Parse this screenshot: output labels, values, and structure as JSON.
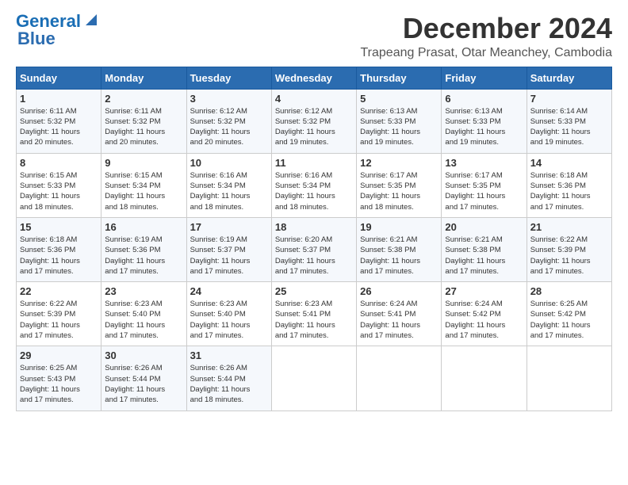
{
  "logo": {
    "line1": "General",
    "line2": "Blue"
  },
  "title": {
    "month_year": "December 2024",
    "location": "Trapeang Prasat, Otar Meanchey, Cambodia"
  },
  "days_of_week": [
    "Sunday",
    "Monday",
    "Tuesday",
    "Wednesday",
    "Thursday",
    "Friday",
    "Saturday"
  ],
  "weeks": [
    [
      {
        "day": "1",
        "info": "Sunrise: 6:11 AM\nSunset: 5:32 PM\nDaylight: 11 hours\nand 20 minutes."
      },
      {
        "day": "2",
        "info": "Sunrise: 6:11 AM\nSunset: 5:32 PM\nDaylight: 11 hours\nand 20 minutes."
      },
      {
        "day": "3",
        "info": "Sunrise: 6:12 AM\nSunset: 5:32 PM\nDaylight: 11 hours\nand 20 minutes."
      },
      {
        "day": "4",
        "info": "Sunrise: 6:12 AM\nSunset: 5:32 PM\nDaylight: 11 hours\nand 19 minutes."
      },
      {
        "day": "5",
        "info": "Sunrise: 6:13 AM\nSunset: 5:33 PM\nDaylight: 11 hours\nand 19 minutes."
      },
      {
        "day": "6",
        "info": "Sunrise: 6:13 AM\nSunset: 5:33 PM\nDaylight: 11 hours\nand 19 minutes."
      },
      {
        "day": "7",
        "info": "Sunrise: 6:14 AM\nSunset: 5:33 PM\nDaylight: 11 hours\nand 19 minutes."
      }
    ],
    [
      {
        "day": "8",
        "info": "Sunrise: 6:15 AM\nSunset: 5:33 PM\nDaylight: 11 hours\nand 18 minutes."
      },
      {
        "day": "9",
        "info": "Sunrise: 6:15 AM\nSunset: 5:34 PM\nDaylight: 11 hours\nand 18 minutes."
      },
      {
        "day": "10",
        "info": "Sunrise: 6:16 AM\nSunset: 5:34 PM\nDaylight: 11 hours\nand 18 minutes."
      },
      {
        "day": "11",
        "info": "Sunrise: 6:16 AM\nSunset: 5:34 PM\nDaylight: 11 hours\nand 18 minutes."
      },
      {
        "day": "12",
        "info": "Sunrise: 6:17 AM\nSunset: 5:35 PM\nDaylight: 11 hours\nand 18 minutes."
      },
      {
        "day": "13",
        "info": "Sunrise: 6:17 AM\nSunset: 5:35 PM\nDaylight: 11 hours\nand 17 minutes."
      },
      {
        "day": "14",
        "info": "Sunrise: 6:18 AM\nSunset: 5:36 PM\nDaylight: 11 hours\nand 17 minutes."
      }
    ],
    [
      {
        "day": "15",
        "info": "Sunrise: 6:18 AM\nSunset: 5:36 PM\nDaylight: 11 hours\nand 17 minutes."
      },
      {
        "day": "16",
        "info": "Sunrise: 6:19 AM\nSunset: 5:36 PM\nDaylight: 11 hours\nand 17 minutes."
      },
      {
        "day": "17",
        "info": "Sunrise: 6:19 AM\nSunset: 5:37 PM\nDaylight: 11 hours\nand 17 minutes."
      },
      {
        "day": "18",
        "info": "Sunrise: 6:20 AM\nSunset: 5:37 PM\nDaylight: 11 hours\nand 17 minutes."
      },
      {
        "day": "19",
        "info": "Sunrise: 6:21 AM\nSunset: 5:38 PM\nDaylight: 11 hours\nand 17 minutes."
      },
      {
        "day": "20",
        "info": "Sunrise: 6:21 AM\nSunset: 5:38 PM\nDaylight: 11 hours\nand 17 minutes."
      },
      {
        "day": "21",
        "info": "Sunrise: 6:22 AM\nSunset: 5:39 PM\nDaylight: 11 hours\nand 17 minutes."
      }
    ],
    [
      {
        "day": "22",
        "info": "Sunrise: 6:22 AM\nSunset: 5:39 PM\nDaylight: 11 hours\nand 17 minutes."
      },
      {
        "day": "23",
        "info": "Sunrise: 6:23 AM\nSunset: 5:40 PM\nDaylight: 11 hours\nand 17 minutes."
      },
      {
        "day": "24",
        "info": "Sunrise: 6:23 AM\nSunset: 5:40 PM\nDaylight: 11 hours\nand 17 minutes."
      },
      {
        "day": "25",
        "info": "Sunrise: 6:23 AM\nSunset: 5:41 PM\nDaylight: 11 hours\nand 17 minutes."
      },
      {
        "day": "26",
        "info": "Sunrise: 6:24 AM\nSunset: 5:41 PM\nDaylight: 11 hours\nand 17 minutes."
      },
      {
        "day": "27",
        "info": "Sunrise: 6:24 AM\nSunset: 5:42 PM\nDaylight: 11 hours\nand 17 minutes."
      },
      {
        "day": "28",
        "info": "Sunrise: 6:25 AM\nSunset: 5:42 PM\nDaylight: 11 hours\nand 17 minutes."
      }
    ],
    [
      {
        "day": "29",
        "info": "Sunrise: 6:25 AM\nSunset: 5:43 PM\nDaylight: 11 hours\nand 17 minutes."
      },
      {
        "day": "30",
        "info": "Sunrise: 6:26 AM\nSunset: 5:44 PM\nDaylight: 11 hours\nand 17 minutes."
      },
      {
        "day": "31",
        "info": "Sunrise: 6:26 AM\nSunset: 5:44 PM\nDaylight: 11 hours\nand 18 minutes."
      },
      {
        "day": "",
        "info": ""
      },
      {
        "day": "",
        "info": ""
      },
      {
        "day": "",
        "info": ""
      },
      {
        "day": "",
        "info": ""
      }
    ]
  ]
}
